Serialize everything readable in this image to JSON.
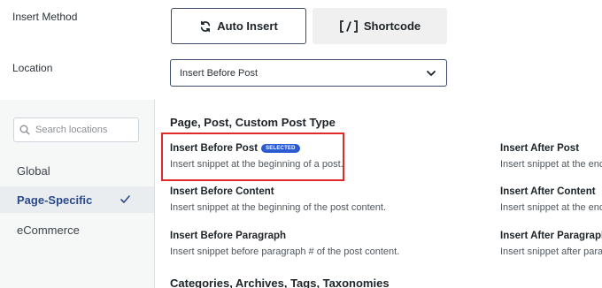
{
  "insert_method": {
    "label": "Insert Method",
    "auto_insert_label": "Auto Insert",
    "shortcode_label": "Shortcode"
  },
  "location": {
    "label": "Location",
    "selected_value": "Insert Before Post"
  },
  "sidebar": {
    "search_placeholder": "Search locations",
    "items": [
      {
        "label": "Global",
        "active": false
      },
      {
        "label": "Page-Specific",
        "active": true
      },
      {
        "label": "eCommerce",
        "active": false
      }
    ]
  },
  "main": {
    "group1_title": "Page, Post, Custom Post Type",
    "group2_title": "Categories, Archives, Tags, Taxonomies",
    "selected_badge": "SELECTED",
    "options": [
      {
        "title": "Insert Before Post",
        "desc": "Insert snippet at the beginning of a post.",
        "selected": true
      },
      {
        "title": "Insert After Post",
        "desc": "Insert snippet at the end of a post."
      },
      {
        "title": "Insert Before Content",
        "desc": "Insert snippet at the beginning of the post content."
      },
      {
        "title": "Insert After Content",
        "desc": "Insert snippet at the end of the post content."
      },
      {
        "title": "Insert Before Paragraph",
        "desc": "Insert snippet before paragraph # of the post content."
      },
      {
        "title": "Insert After Paragraph",
        "desc": "Insert snippet after paragraph # of the post content."
      }
    ]
  },
  "colors": {
    "accent": "#2b4a8a",
    "badge": "#2b5bd3",
    "highlight_box": "#e02a2a"
  },
  "icons": [
    "sync-arrows-icon",
    "shortcode-brackets-icon",
    "chevron-down-icon",
    "search-icon",
    "checkmark-icon"
  ]
}
